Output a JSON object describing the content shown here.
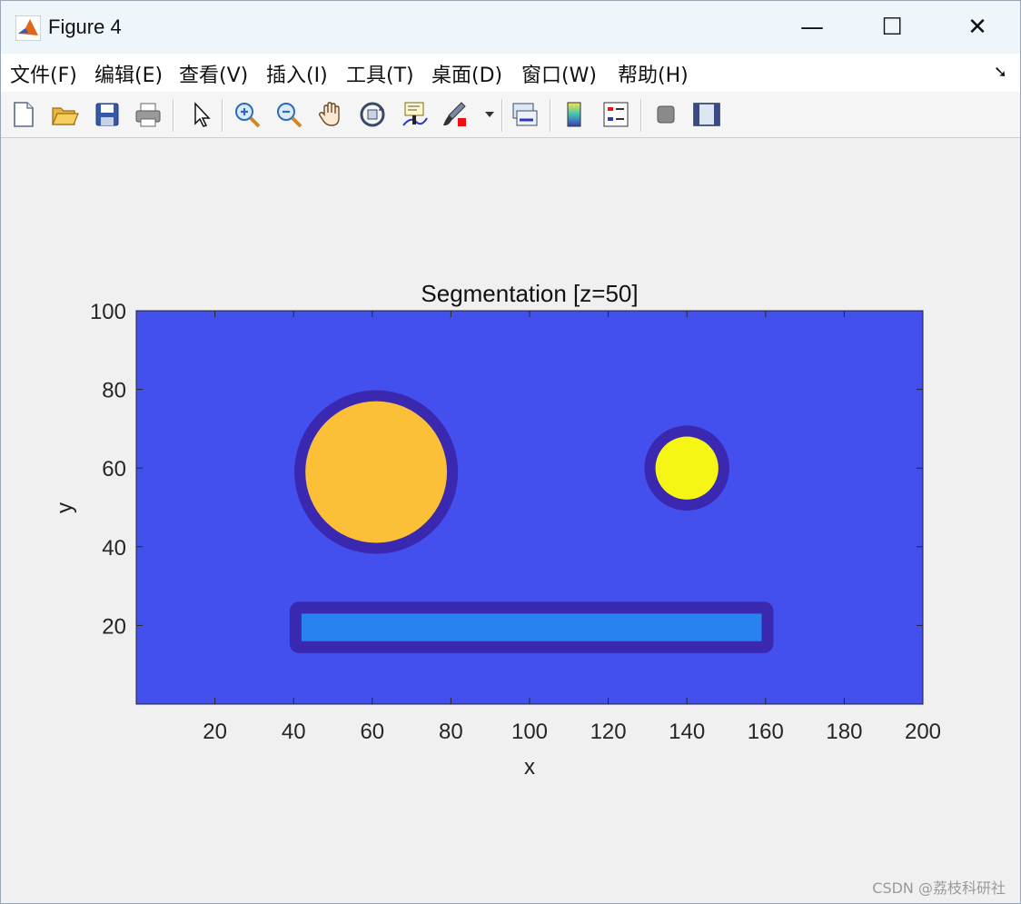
{
  "window": {
    "title": "Figure 4",
    "minimize_label": "—",
    "maximize_label": "☐",
    "close_label": "✕"
  },
  "menubar": {
    "items": [
      {
        "label": "文件(F)"
      },
      {
        "label": "编辑(E)"
      },
      {
        "label": "查看(V)"
      },
      {
        "label": "插入(I)"
      },
      {
        "label": "工具(T)"
      },
      {
        "label": "桌面(D)"
      },
      {
        "label": "窗口(W)"
      },
      {
        "label": "帮助(H)"
      }
    ],
    "overflow_arrow": "➘"
  },
  "toolbar": {
    "icons": [
      "new-file-icon",
      "open-folder-icon",
      "save-icon",
      "print-icon",
      "pointer-icon",
      "zoom-in-icon",
      "zoom-out-icon",
      "pan-hand-icon",
      "rotate-3d-icon",
      "data-cursor-icon",
      "brush-icon",
      "link-plot-icon",
      "colorbar-icon",
      "legend-icon",
      "hide-plot-tools-icon",
      "show-plot-tools-icon"
    ]
  },
  "chart_data": {
    "type": "heatmap",
    "title": "Segmentation [z=50]",
    "xlabel": "x",
    "ylabel": "y",
    "xlim": [
      0,
      200
    ],
    "ylim": [
      0,
      100
    ],
    "xticks": [
      20,
      40,
      60,
      80,
      100,
      120,
      140,
      160,
      180,
      200
    ],
    "yticks": [
      20,
      40,
      60,
      80,
      100
    ],
    "colors": {
      "background": "#4450ee",
      "boundary": "#3a28b0",
      "large_circle": "#fcbf38",
      "small_circle": "#f6f615",
      "bar": "#2883f0"
    },
    "regions": [
      {
        "label": "large_circle",
        "center_x": 61,
        "center_y": 59,
        "radius": 18,
        "boundary_width": 2.8
      },
      {
        "label": "small_circle",
        "center_x": 140,
        "center_y": 60,
        "radius": 8,
        "boundary_width": 2.8
      },
      {
        "label": "bar",
        "x_start": 42,
        "x_end": 159,
        "y_start": 16,
        "y_end": 23,
        "boundary_width": 3
      }
    ]
  },
  "watermark": "CSDN @荔枝科研社"
}
